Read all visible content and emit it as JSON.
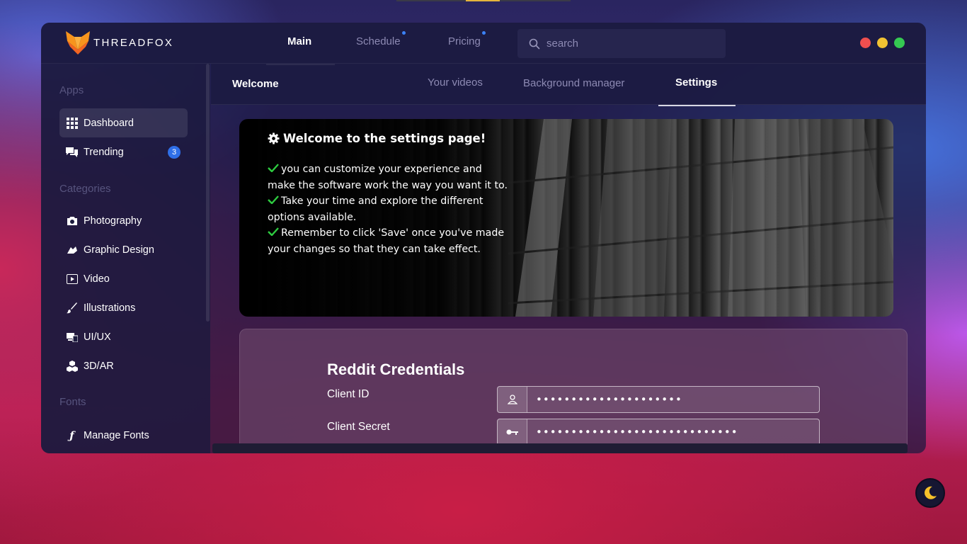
{
  "app": {
    "name": "THREADFOX"
  },
  "main_nav": {
    "tabs": [
      {
        "label": "Main",
        "active": true,
        "dot": false
      },
      {
        "label": "Schedule",
        "active": false,
        "dot": true
      },
      {
        "label": "Pricing",
        "active": false,
        "dot": true
      }
    ]
  },
  "search": {
    "placeholder": "search",
    "value": ""
  },
  "window_controls": {
    "colors": [
      "#ef4f4f",
      "#f1c232",
      "#35c952"
    ]
  },
  "sidebar": {
    "sections": [
      {
        "label": "Apps",
        "items": [
          {
            "label": "Dashboard",
            "icon": "grid-icon",
            "active": true
          },
          {
            "label": "Trending",
            "icon": "chat-icon",
            "badge": "3"
          }
        ]
      },
      {
        "label": "Categories",
        "items": [
          {
            "label": "Photography",
            "icon": "camera-icon"
          },
          {
            "label": "Graphic Design",
            "icon": "pen-tool-icon"
          },
          {
            "label": "Video",
            "icon": "video-icon"
          },
          {
            "label": "Illustrations",
            "icon": "brush-icon"
          },
          {
            "label": "UI/UX",
            "icon": "devices-icon"
          },
          {
            "label": "3D/AR",
            "icon": "cubes-icon"
          }
        ]
      },
      {
        "label": "Fonts",
        "items": [
          {
            "label": "Manage Fonts",
            "icon": "font-icon"
          }
        ]
      }
    ]
  },
  "sub_nav": {
    "title": "Welcome",
    "tabs": [
      {
        "label": "Your videos",
        "active": false
      },
      {
        "label": "Background manager",
        "active": false
      },
      {
        "label": "Settings",
        "active": true
      }
    ]
  },
  "hero": {
    "title": "Welcome to the settings page!",
    "lines": [
      "you can customize your experience and make the software work the way you want it to.",
      "Take your time and explore the different options available.",
      "Remember to click 'Save' once you've made your changes so that they can take effect."
    ]
  },
  "credentials": {
    "title": "Reddit Credentials",
    "client_id": {
      "label": "Client ID",
      "value": "•••••••••••••••••••••",
      "icon": "user-icon"
    },
    "client_secret": {
      "label": "Client Secret",
      "value": "•••••••••••••••••••••••••••••",
      "icon": "key-icon"
    }
  },
  "theme": {
    "icon": "moon-icon",
    "accent": "#f6c12a"
  }
}
